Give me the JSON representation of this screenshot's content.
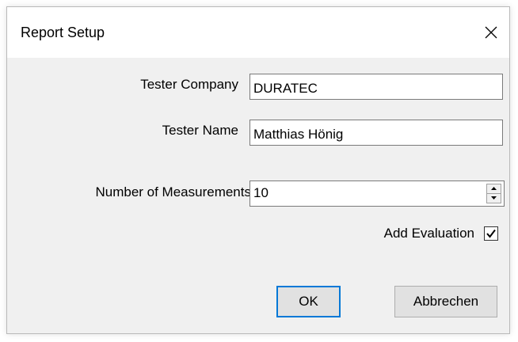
{
  "window": {
    "title": "Report Setup",
    "close_icon": "close-icon"
  },
  "form": {
    "tester_company": {
      "label": "Tester Company",
      "value": "DURATEC"
    },
    "tester_name": {
      "label": "Tester Name",
      "value": "Matthias Hönig"
    },
    "number_of_measurements": {
      "label": "Number of Measurements",
      "value": "10"
    },
    "add_evaluation": {
      "label": "Add Evaluation",
      "checked": true
    }
  },
  "buttons": {
    "ok": "OK",
    "cancel": "Abbrechen"
  },
  "colors": {
    "accent": "#0078d7",
    "dialog_bg": "#f0f0f0"
  }
}
